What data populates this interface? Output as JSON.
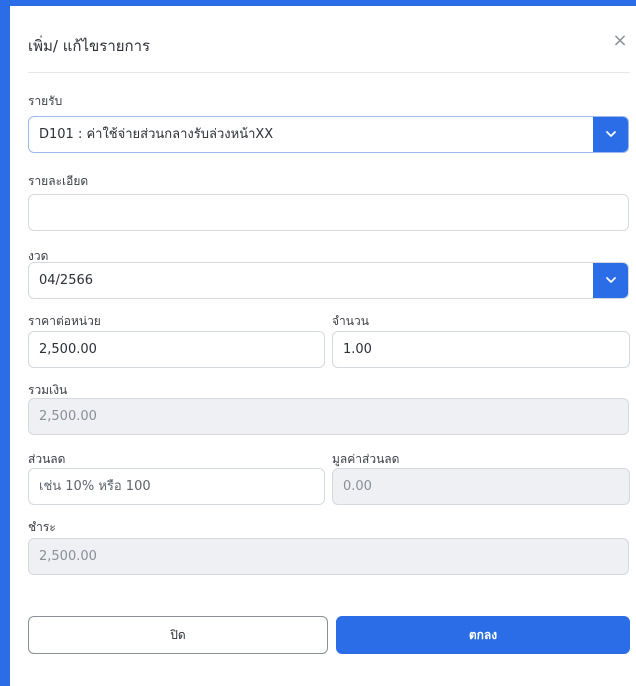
{
  "modal": {
    "title": "เพิ่ม/ แก้ไขรายการ",
    "close_glyph": "×"
  },
  "fields": {
    "income": {
      "label": "รายรับ",
      "value": "D101 : ค่าใช้จ่ายส่วนกลางรับล่วงหน้าXX"
    },
    "detail": {
      "label": "รายละเอียด",
      "value": ""
    },
    "period": {
      "label": "งวด",
      "value": "04/2566"
    },
    "unit_price": {
      "label": "ราคาต่อหน่วย",
      "value": "2,500.00"
    },
    "quantity": {
      "label": "จำนวน",
      "value": "1.00"
    },
    "total": {
      "label": "รวมเงิน",
      "value": "2,500.00"
    },
    "discount": {
      "label": "ส่วนลด",
      "placeholder": "เช่น 10% หรือ 100"
    },
    "discount_value": {
      "label": "มูลค่าส่วนลด",
      "value": "0.00"
    },
    "payment": {
      "label": "ชำระ",
      "value": "2,500.00"
    }
  },
  "buttons": {
    "close_label": "ปิด",
    "ok_label": "ตกลง"
  },
  "colors": {
    "primary": "#2a6de6",
    "disabled_bg": "#eef0f3",
    "border": "#d5d9df"
  },
  "icons": {
    "close": "close-icon",
    "dropdown": "chevron-down-icon"
  }
}
